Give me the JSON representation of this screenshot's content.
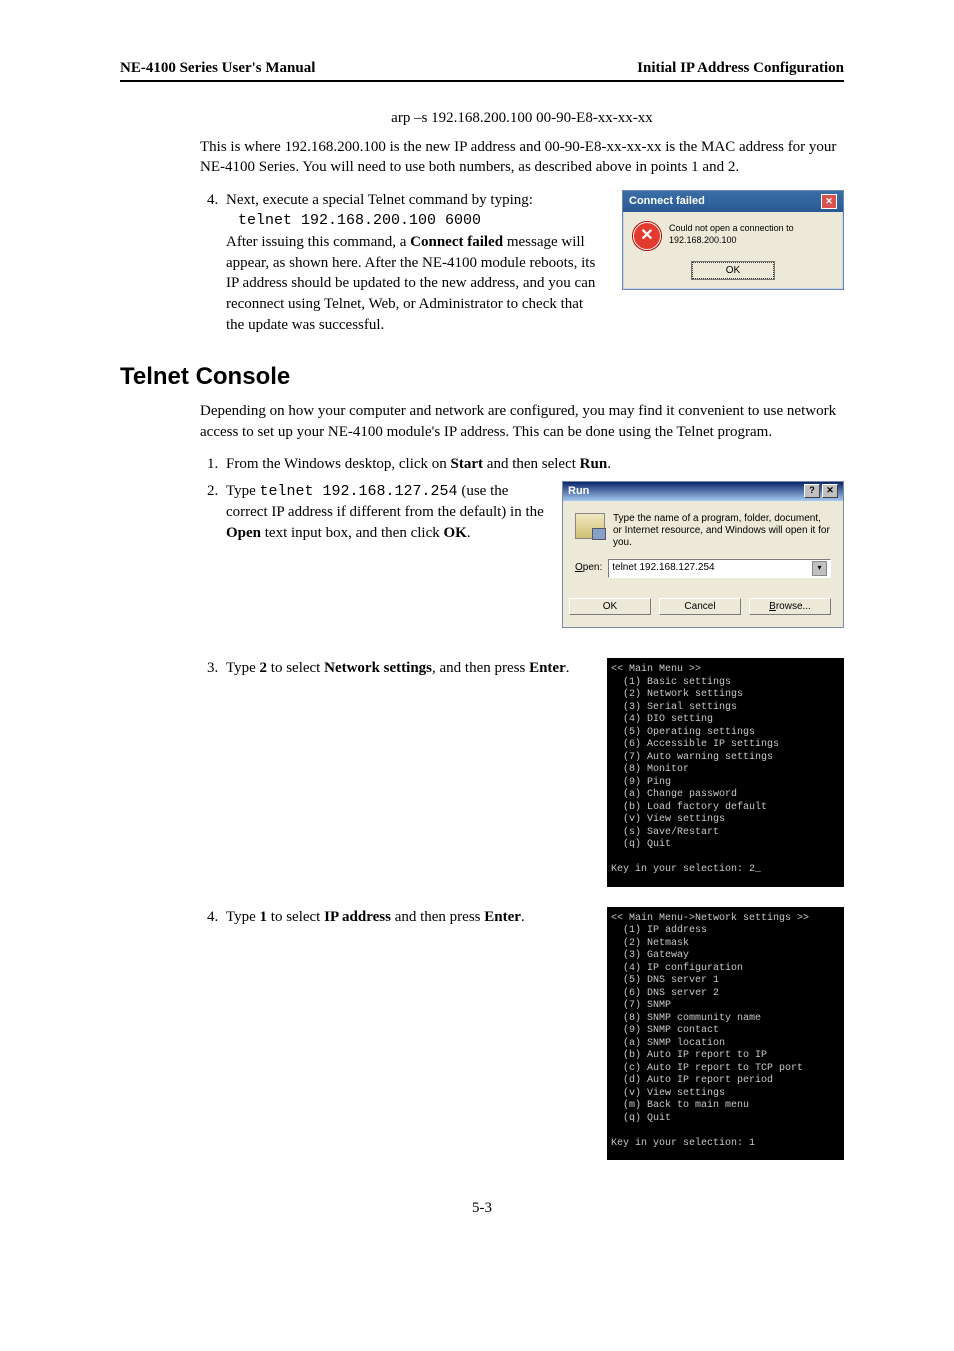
{
  "header": {
    "left": "NE-4100 Series User's Manual",
    "right": "Initial IP Address Configuration"
  },
  "arp_line": "arp –s 192.168.200.100 00-90-E8-xx-xx-xx",
  "arp_para": "This is where 192.168.200.100 is the new IP address and 00-90-E8-xx-xx-xx is the MAC address for your NE-4100 Series. You will need to use both numbers, as described above in points 1 and 2.",
  "step4": {
    "lead": "Next, execute a special Telnet command by typing:",
    "cmd": "telnet 192.168.200.100 6000",
    "tail_a": "After issuing this command, a ",
    "tail_b": "Connect failed",
    "tail_c": " message will appear, as shown here. After the NE-4100 module reboots, its IP address should be updated to the new address, and you can reconnect using Telnet, Web, or Administrator to check that the update was successful."
  },
  "connect_failed": {
    "title": "Connect failed",
    "msg": "Could not open a connection to 192.168.200.100",
    "ok": "OK"
  },
  "telnet_heading": "Telnet Console",
  "telnet_intro": "Depending on how your computer and network are configured, you may find it convenient to use network access to set up your NE-4100 module's IP address. This can be done using the Telnet program.",
  "tc_step1_a": "From the Windows desktop, click on ",
  "tc_step1_b": "Start",
  "tc_step1_c": " and then select ",
  "tc_step1_d": "Run",
  "tc_step1_e": ".",
  "tc_step2_a": "Type ",
  "tc_step2_cmd": "telnet 192.168.127.254",
  "tc_step2_b": " (use the correct IP address if different from the default) in the ",
  "tc_step2_c": "Open",
  "tc_step2_d": " text input box, and then click ",
  "tc_step2_e": "OK",
  "tc_step2_f": ".",
  "run": {
    "title": "Run",
    "desc": "Type the name of a program, folder, document, or Internet resource, and Windows will open it for you.",
    "label_html": "Open:",
    "value": "telnet 192.168.127.254",
    "ok": "OK",
    "cancel": "Cancel",
    "browse": "Browse..."
  },
  "tc_step3_a": "Type ",
  "tc_step3_b": "2",
  "tc_step3_c": " to select ",
  "tc_step3_d": "Network settings",
  "tc_step3_e": ", and then press ",
  "tc_step3_f": "Enter",
  "tc_step3_g": ".",
  "main_menu": "<< Main Menu >>\n  (1) Basic settings\n  (2) Network settings\n  (3) Serial settings\n  (4) DIO setting\n  (5) Operating settings\n  (6) Accessible IP settings\n  (7) Auto warning settings\n  (8) Monitor\n  (9) Ping\n  (a) Change password\n  (b) Load factory default\n  (v) View settings\n  (s) Save/Restart\n  (q) Quit\n\nKey in your selection: 2_",
  "tc_step4_a": "Type ",
  "tc_step4_b": "1",
  "tc_step4_c": " to select ",
  "tc_step4_d": "IP address",
  "tc_step4_e": " and then press ",
  "tc_step4_f": "Enter",
  "tc_step4_g": ".",
  "net_menu": "<< Main Menu->Network settings >>\n  (1) IP address\n  (2) Netmask\n  (3) Gateway\n  (4) IP configuration\n  (5) DNS server 1\n  (6) DNS server 2\n  (7) SNMP\n  (8) SNMP community name\n  (9) SNMP contact\n  (a) SNMP location\n  (b) Auto IP report to IP\n  (c) Auto IP report to TCP port\n  (d) Auto IP report period\n  (v) View settings\n  (m) Back to main menu\n  (q) Quit\n\nKey in your selection: 1",
  "page_num": "5-3"
}
